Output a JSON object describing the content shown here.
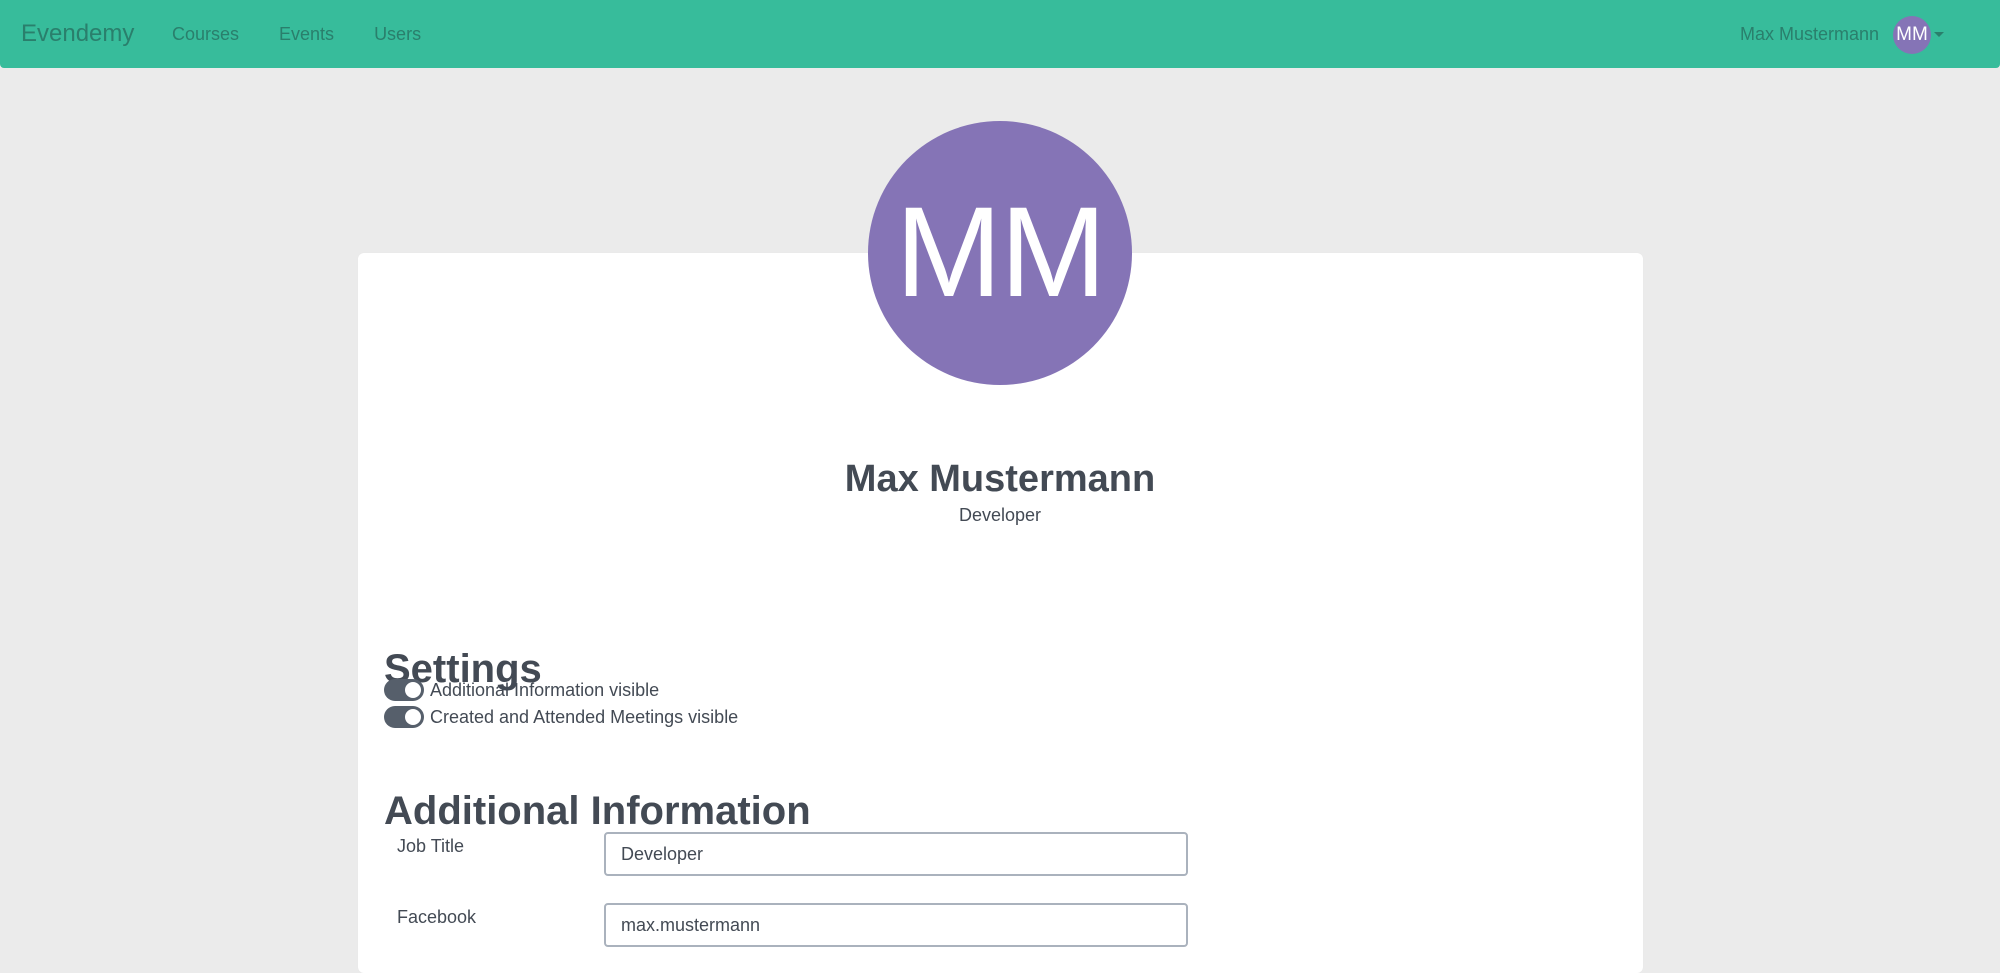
{
  "navbar": {
    "brand": "Evendemy",
    "links": [
      "Courses",
      "Events",
      "Users"
    ],
    "user_name": "Max Mustermann",
    "user_initials": "MM",
    "menu_icon": "caret-down-icon"
  },
  "profile": {
    "initials": "MM",
    "name": "Max Mustermann",
    "title": "Developer"
  },
  "settings": {
    "heading": "Settings",
    "toggles": [
      {
        "label": "Additional Information visible",
        "on": true
      },
      {
        "label": "Created and Attended Meetings visible",
        "on": true
      }
    ]
  },
  "additional_info": {
    "heading": "Additional Information",
    "fields": [
      {
        "label": "Job Title",
        "value": "Developer"
      },
      {
        "label": "Facebook",
        "value": "max.mustermann"
      }
    ]
  },
  "colors": {
    "navbar": "#37bc9b",
    "navbar_text": "#2a7f6c",
    "avatar": "#8574b6",
    "background": "#ebebeb",
    "text": "#434a54",
    "toggle": "#565f6b"
  }
}
